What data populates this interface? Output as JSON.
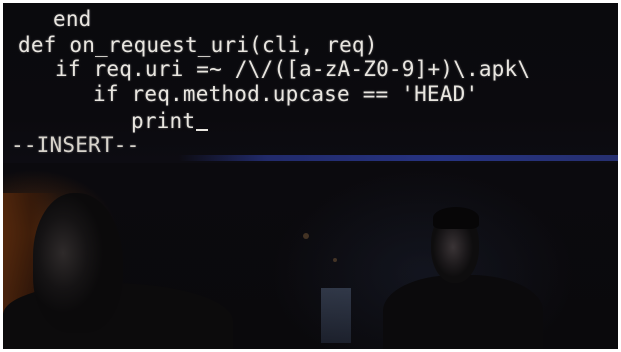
{
  "editor": {
    "lines": [
      "end",
      "def on_request_uri(cli, req)",
      "if req.uri =~ /\\/([a-zA-Z0-9]+)\\.apk\\",
      "if req.method.upcase == 'HEAD'",
      "print",
      "--INSERT--"
    ],
    "mode": "INSERT"
  },
  "colors": {
    "text": "#e9e6e0",
    "background": "#0a0a0d",
    "accent_bar": "#2b3a95"
  }
}
